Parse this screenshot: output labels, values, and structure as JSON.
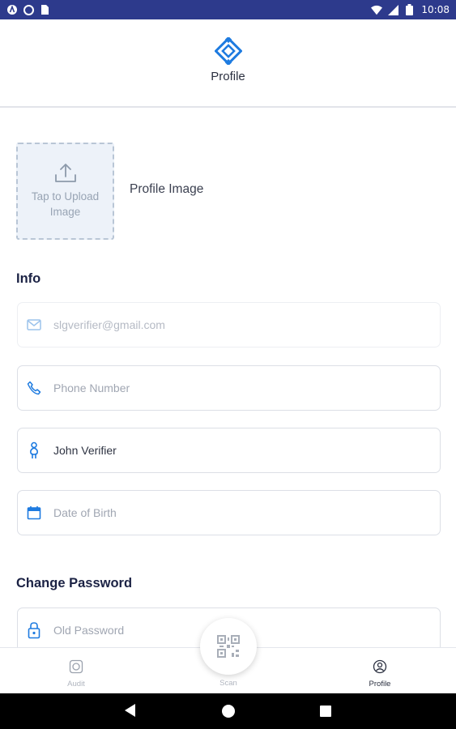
{
  "status_bar": {
    "time": "10:08",
    "left_icons": [
      "a-circle-icon",
      "circle-icon",
      "sim-card-icon"
    ],
    "right_icons": [
      "wifi-icon",
      "signal-icon",
      "battery-icon"
    ],
    "background": "#2d3a8c"
  },
  "header": {
    "title": "Profile",
    "logo_icon": "diamond-logo-icon",
    "accent_color": "#1e7be0"
  },
  "profile_image": {
    "upload_text": "Tap to Upload Image",
    "label": "Profile Image",
    "icon": "upload-icon"
  },
  "info": {
    "title": "Info",
    "email": {
      "value": "slgverifier@gmail.com",
      "icon": "mail-icon",
      "disabled": true
    },
    "phone": {
      "placeholder": "Phone Number",
      "icon": "phone-icon"
    },
    "name": {
      "value": "John Verifier",
      "icon": "person-icon"
    },
    "dob": {
      "placeholder": "Date of Birth",
      "icon": "calendar-icon"
    }
  },
  "change_password": {
    "title": "Change Password",
    "old_password": {
      "placeholder": "Old Password",
      "icon": "lock-icon"
    }
  },
  "bottom_nav": {
    "items": [
      {
        "label": "Audit",
        "icon": "audit-icon",
        "active": false
      },
      {
        "label": "Scan",
        "icon": "qr-code-icon",
        "active": false
      },
      {
        "label": "Profile",
        "icon": "profile-icon",
        "active": true
      }
    ]
  },
  "android_nav": {
    "buttons": [
      "back-icon",
      "home-icon",
      "recents-icon"
    ]
  }
}
